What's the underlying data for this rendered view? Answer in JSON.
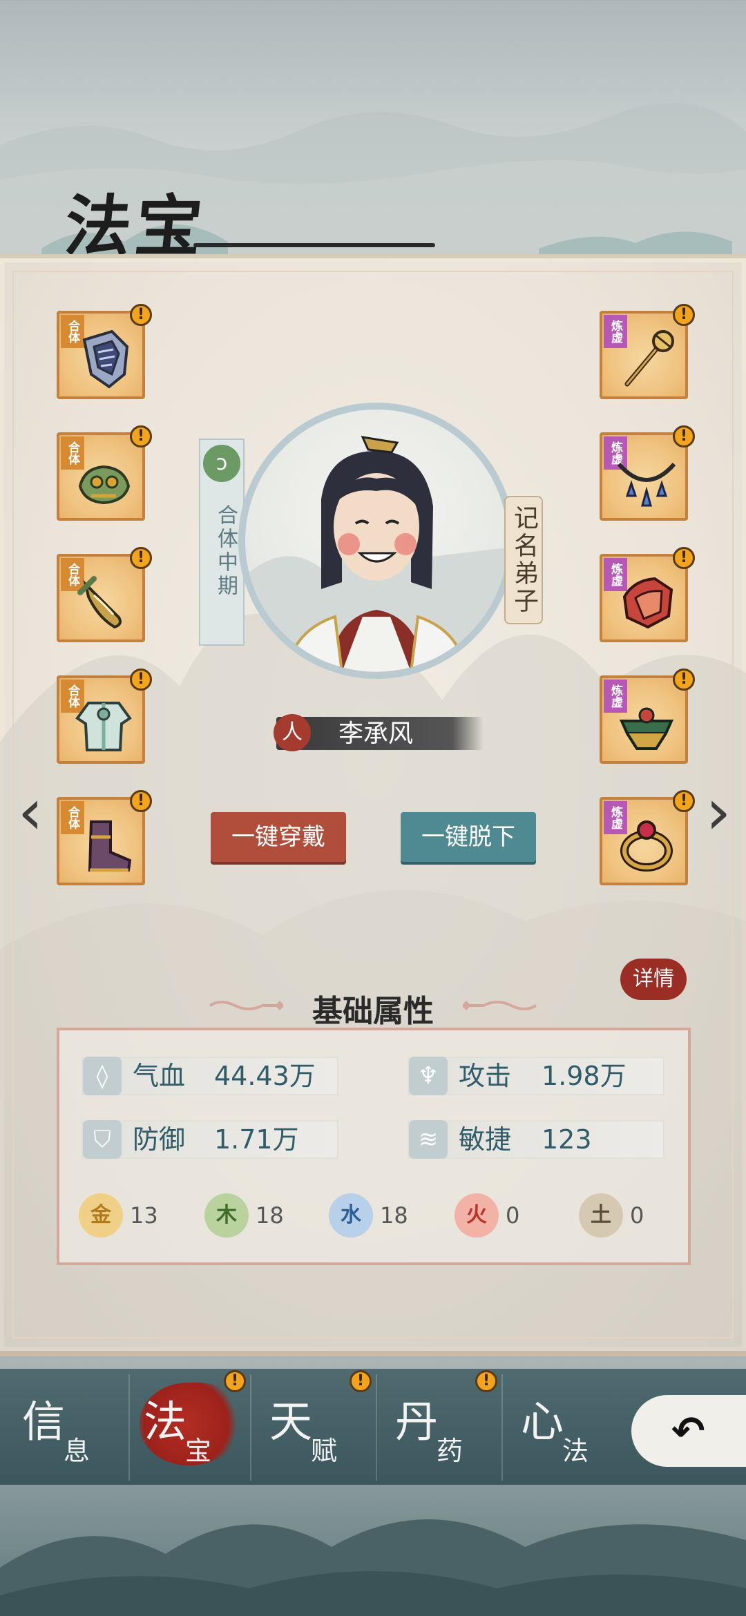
{
  "page": {
    "title": "法宝"
  },
  "left_slots": [
    {
      "tag": "合体",
      "alert": "!",
      "item": "breastplate"
    },
    {
      "tag": "合体",
      "alert": "!",
      "item": "beast-guard"
    },
    {
      "tag": "合体",
      "alert": "!",
      "item": "dagger"
    },
    {
      "tag": "合体",
      "alert": "!",
      "item": "robe"
    },
    {
      "tag": "合体",
      "alert": "!",
      "item": "boots"
    }
  ],
  "right_slots": [
    {
      "tag": "炼虚",
      "alert": "!",
      "item": "staff"
    },
    {
      "tag": "炼虚",
      "alert": "!",
      "item": "necklace"
    },
    {
      "tag": "炼虚",
      "alert": "!",
      "item": "red-armor"
    },
    {
      "tag": "炼虚",
      "alert": "!",
      "item": "helmet"
    },
    {
      "tag": "炼虚",
      "alert": "!",
      "item": "ring"
    }
  ],
  "character": {
    "realm": "合体中期",
    "rank": "记名弟子",
    "race_badge": "人",
    "name": "李承风"
  },
  "buttons": {
    "wear_all": "一键穿戴",
    "remove_all": "一键脱下",
    "details": "详情"
  },
  "nav": {
    "prev": "‹",
    "next": "›"
  },
  "attributes": {
    "title": "基础属性",
    "stats": [
      {
        "label": "气血",
        "value": "44.43万",
        "icon": "blood-drop-icon"
      },
      {
        "label": "攻击",
        "value": "1.98万",
        "icon": "attack-icon"
      },
      {
        "label": "防御",
        "value": "1.71万",
        "icon": "shield-icon"
      },
      {
        "label": "敏捷",
        "value": "123",
        "icon": "wind-wing-icon"
      }
    ],
    "elements": [
      {
        "glyph": "金",
        "value": "13",
        "color": "#e8b24a"
      },
      {
        "glyph": "木",
        "value": "18",
        "color": "#7ea95c"
      },
      {
        "glyph": "水",
        "value": "18",
        "color": "#6a9cc9"
      },
      {
        "glyph": "火",
        "value": "0",
        "color": "#d45a4a"
      },
      {
        "glyph": "土",
        "value": "0",
        "color": "#8b7a62"
      }
    ]
  },
  "tabs": [
    {
      "big": "信",
      "small": "息",
      "alert": ""
    },
    {
      "big": "法",
      "small": "宝",
      "alert": "!"
    },
    {
      "big": "天",
      "small": "赋",
      "alert": "!"
    },
    {
      "big": "丹",
      "small": "药",
      "alert": "!"
    },
    {
      "big": "心",
      "small": "法",
      "alert": ""
    }
  ],
  "back": {
    "glyph": "↶"
  },
  "colors": {
    "accent_red": "#b14e3b",
    "accent_teal": "#4f8a92",
    "slot_gold": "#efc27f"
  }
}
